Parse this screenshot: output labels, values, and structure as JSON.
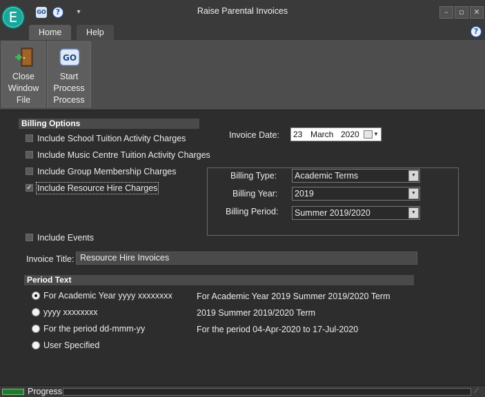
{
  "window": {
    "title": "Raise Parental Invoices",
    "orb_letter": "E",
    "quick_access": {
      "go_label": "GO",
      "help_label": "?",
      "dropdown_label": "▾"
    },
    "controls": {
      "minimize": "–",
      "maximize": "▫",
      "close": "✕"
    }
  },
  "ribbon": {
    "tabs": [
      {
        "label": "Home",
        "active": true
      },
      {
        "label": "Help",
        "active": false
      }
    ],
    "help_label": "?",
    "buttons": [
      {
        "lines": [
          "Close",
          "Window",
          "File"
        ],
        "icon": "door-exit-icon"
      },
      {
        "lines": [
          "Start",
          "Process",
          "Process"
        ],
        "icon": "go-icon",
        "icon_text": "GO"
      }
    ]
  },
  "billing_options": {
    "heading": "Billing Options",
    "items": [
      {
        "label": "Include School Tuition Activity Charges",
        "checked": false
      },
      {
        "label": "Include Music Centre Tuition Activity Charges",
        "checked": false
      },
      {
        "label": "Include Group Membership Charges",
        "checked": false
      },
      {
        "label": "Include Resource Hire Charges",
        "checked": true
      }
    ],
    "include_events": {
      "label": "Include Events",
      "checked": false
    }
  },
  "invoice_date": {
    "label": "Invoice Date:",
    "day": "23",
    "month": "March",
    "year": "2020"
  },
  "billing": {
    "type_label": "Billing Type:",
    "type_value": "Academic Terms",
    "year_label": "Billing Year:",
    "year_value": "2019",
    "period_label": "Billing Period:",
    "period_value": "Summer 2019/2020"
  },
  "invoice_title": {
    "label": "Invoice Title:",
    "value": "Resource Hire Invoices"
  },
  "period_text": {
    "heading": "Period Text",
    "options": [
      {
        "label": "For Academic Year yyyy xxxxxxxx",
        "preview": "For Academic Year 2019 Summer 2019/2020 Term",
        "selected": true
      },
      {
        "label": "yyyy xxxxxxxx",
        "preview": "2019 Summer 2019/2020 Term",
        "selected": false
      },
      {
        "label": "For the period dd-mmm-yy",
        "preview": "For the period 04-Apr-2020 to 17-Jul-2020",
        "selected": false
      },
      {
        "label": "User Specified",
        "preview": "",
        "selected": false
      }
    ]
  },
  "status": {
    "label": "Progress",
    "progress": 0
  },
  "colors": {
    "accent": "#16a89a",
    "progress_fill": "#2e8b3a",
    "background": "#2d2d2d"
  }
}
